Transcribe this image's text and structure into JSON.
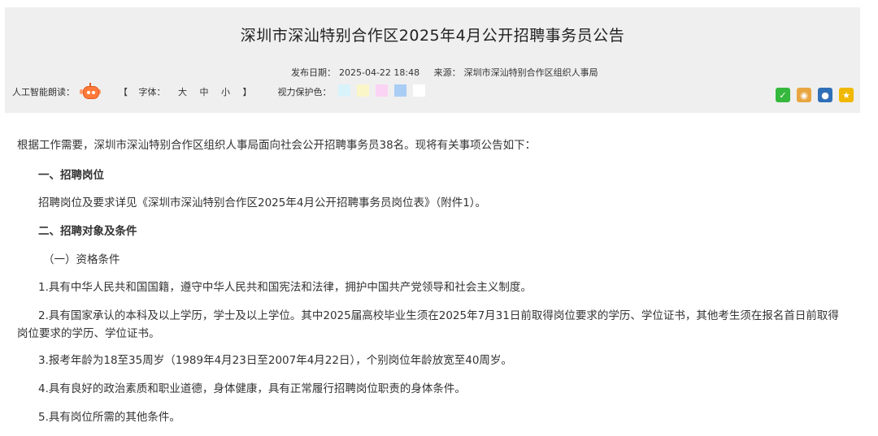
{
  "article": {
    "title": "深圳市深汕特别合作区2025年4月公开招聘事务员公告",
    "publish_label": "发布日期：",
    "publish_date": "2025-04-22 18:48",
    "source_label": "来源：",
    "source": "深圳市深汕特别合作区组织人事局"
  },
  "toolbar": {
    "ai_read_label": "人工智能朗读：",
    "font_open": "【",
    "font_label": "字体：",
    "font_large": "大",
    "font_medium": "中",
    "font_small": "小",
    "font_close": "】",
    "vision_label": "视力保护色：",
    "swatches": [
      "#d9f3fb",
      "#fbf6c8",
      "#fbd3f4",
      "#a9cdf5",
      "#ffffff"
    ]
  },
  "share": {
    "icons": [
      "wechat-icon",
      "weibo-icon",
      "qq-icon",
      "qzone-icon"
    ],
    "colors": [
      "#35b83c",
      "#e8a640",
      "#2f6fb8",
      "#f0b800"
    ]
  },
  "content": {
    "intro": "根据工作需要，深圳市深汕特别合作区组织人事局面向社会公开招聘事务员38名。现将有关事项公告如下：",
    "h1": "一、招聘岗位",
    "h1_body": "招聘岗位及要求详见《深圳市深汕特别合作区2025年4月公开招聘事务员岗位表》（附件1）。",
    "h2": "二、招聘对象及条件",
    "sub1": "（一）资格条件",
    "c1": "1.具有中华人民共和国国籍，遵守中华人民共和国宪法和法律，拥护中国共产党领导和社会主义制度。",
    "c2": "2.具有国家承认的本科及以上学历，学士及以上学位。其中2025届高校毕业生须在2025年7月31日前取得岗位要求的学历、学位证书，其他考生须在报名首日前取得岗位要求的学历、学位证书。",
    "c3": "3.报考年龄为18至35周岁（1989年4月23日至2007年4月22日），个别岗位年龄放宽至40周岁。",
    "c4": "4.具有良好的政治素质和职业道德，身体健康，具有正常履行招聘岗位职责的身体条件。",
    "c5": "5.具有岗位所需的其他条件。"
  }
}
